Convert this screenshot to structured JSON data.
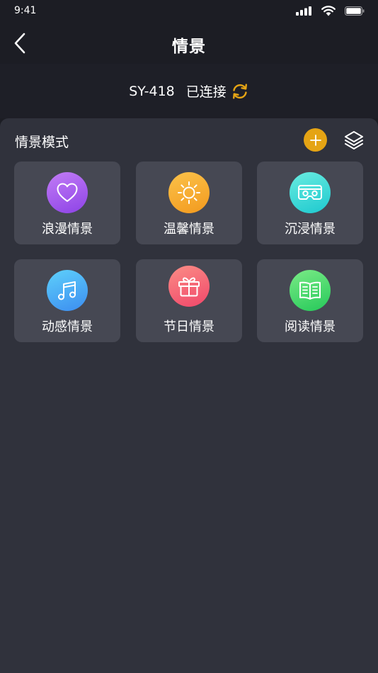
{
  "status_bar": {
    "time": "9:41",
    "icons": [
      "signal-icon",
      "wifi-icon",
      "battery-icon"
    ]
  },
  "nav": {
    "title": "情景",
    "back_icon": "chevron-left-icon"
  },
  "device": {
    "name": "SY-418",
    "status": "已连接",
    "refresh_icon": "refresh-icon",
    "accent_color": "#e5a414"
  },
  "section": {
    "title": "情景模式",
    "add_icon": "plus-icon",
    "layers_icon": "layers-icon"
  },
  "scenes": [
    {
      "label": "浪漫情景",
      "icon": "heart-icon",
      "gradient": [
        "#c27cf6",
        "#8d43e6"
      ]
    },
    {
      "label": "温馨情景",
      "icon": "sun-icon",
      "gradient": [
        "#fbc24a",
        "#f39a1e"
      ]
    },
    {
      "label": "沉浸情景",
      "icon": "vr-headset-icon",
      "gradient": [
        "#69ece0",
        "#1ec9cf"
      ]
    },
    {
      "label": "动感情景",
      "icon": "music-note-icon",
      "gradient": [
        "#5ed0fb",
        "#3c8df0"
      ]
    },
    {
      "label": "节日情景",
      "icon": "gift-icon",
      "gradient": [
        "#fb8d86",
        "#f0476a"
      ]
    },
    {
      "label": "阅读情景",
      "icon": "book-icon",
      "gradient": [
        "#7aeb86",
        "#26c95a"
      ]
    }
  ]
}
